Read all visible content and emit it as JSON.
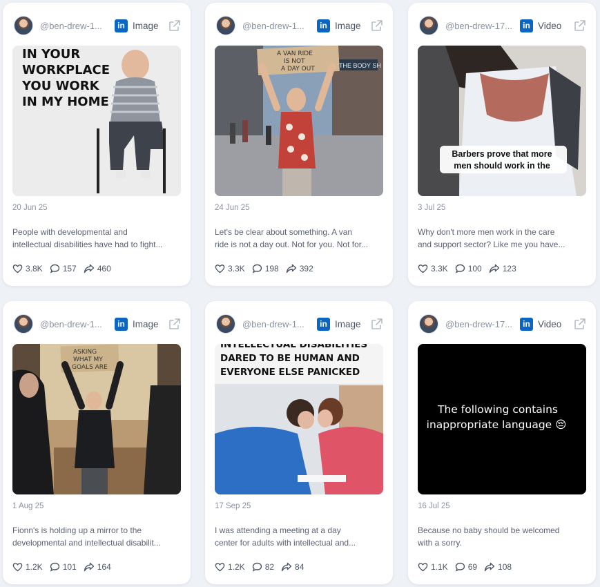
{
  "cards": [
    {
      "handle": "@ben-drew-1...",
      "platform_icon": "linkedin-icon",
      "type": "Image",
      "date": "20 Jun 25",
      "desc_line1": "People with developmental and",
      "desc_line2": "intellectual disabilities have had to fight...",
      "likes": "3.8K",
      "comments": "157",
      "shares": "460",
      "media_text": [
        "IN YOUR",
        "WORKPLACE",
        "YOU WORK",
        "IN MY HOME"
      ]
    },
    {
      "handle": "@ben-drew-1...",
      "platform_icon": "linkedin-icon",
      "type": "Image",
      "date": "24 Jun 25",
      "desc_line1": "Let's be clear about something. A van",
      "desc_line2": "ride is not a day out. Not for you. Not for...",
      "likes": "3.3K",
      "comments": "198",
      "shares": "392",
      "media_text": [
        "A VAN RIDE",
        "IS NOT",
        "A DAY OUT"
      ],
      "storefront_text": "THE BODY SH"
    },
    {
      "handle": "@ben-drew-17...",
      "platform_icon": "linkedin-icon",
      "type": "Video",
      "date": "3 Jul 25",
      "desc_line1": "Why don't more men work in the care",
      "desc_line2": "and support sector? Like me you have...",
      "likes": "3.3K",
      "comments": "100",
      "shares": "123",
      "media_text": [
        "Barbers prove that more",
        "men should work in the"
      ]
    },
    {
      "handle": "@ben-drew-1...",
      "platform_icon": "linkedin-icon",
      "type": "Image",
      "date": "1 Aug 25",
      "desc_line1": "Fionn's is holding up a mirror to the",
      "desc_line2": "developmental and intellectual disabilit...",
      "likes": "1.2K",
      "comments": "101",
      "shares": "164",
      "media_text": [
        "ASKING",
        "WHAT MY",
        "GOALS ARE"
      ]
    },
    {
      "handle": "@ben-drew-1...",
      "platform_icon": "linkedin-icon",
      "type": "Image",
      "date": "17 Sep 25",
      "desc_line1": "I was attending a meeting at a day",
      "desc_line2": "center for adults with intellectual and...",
      "likes": "1.2K",
      "comments": "82",
      "shares": "84",
      "media_text": [
        "INTELLECTUAL DISABILITIES",
        "DARED TO BE HUMAN AND",
        "EVERYONE ELSE PANICKED"
      ]
    },
    {
      "handle": "@ben-drew-17...",
      "platform_icon": "linkedin-icon",
      "type": "Video",
      "date": "16 Jul 25",
      "desc_line1": "Because no baby should be welcomed",
      "desc_line2": "with a sorry.",
      "likes": "1.1K",
      "comments": "69",
      "shares": "108",
      "media_text": [
        "The following contains",
        "inappropriate language 😔"
      ]
    }
  ],
  "colors": {
    "page_bg": "#eef1f6",
    "card_bg": "#ffffff",
    "linkedin_blue": "#0a66c2",
    "muted_text": "#8a92a2"
  }
}
